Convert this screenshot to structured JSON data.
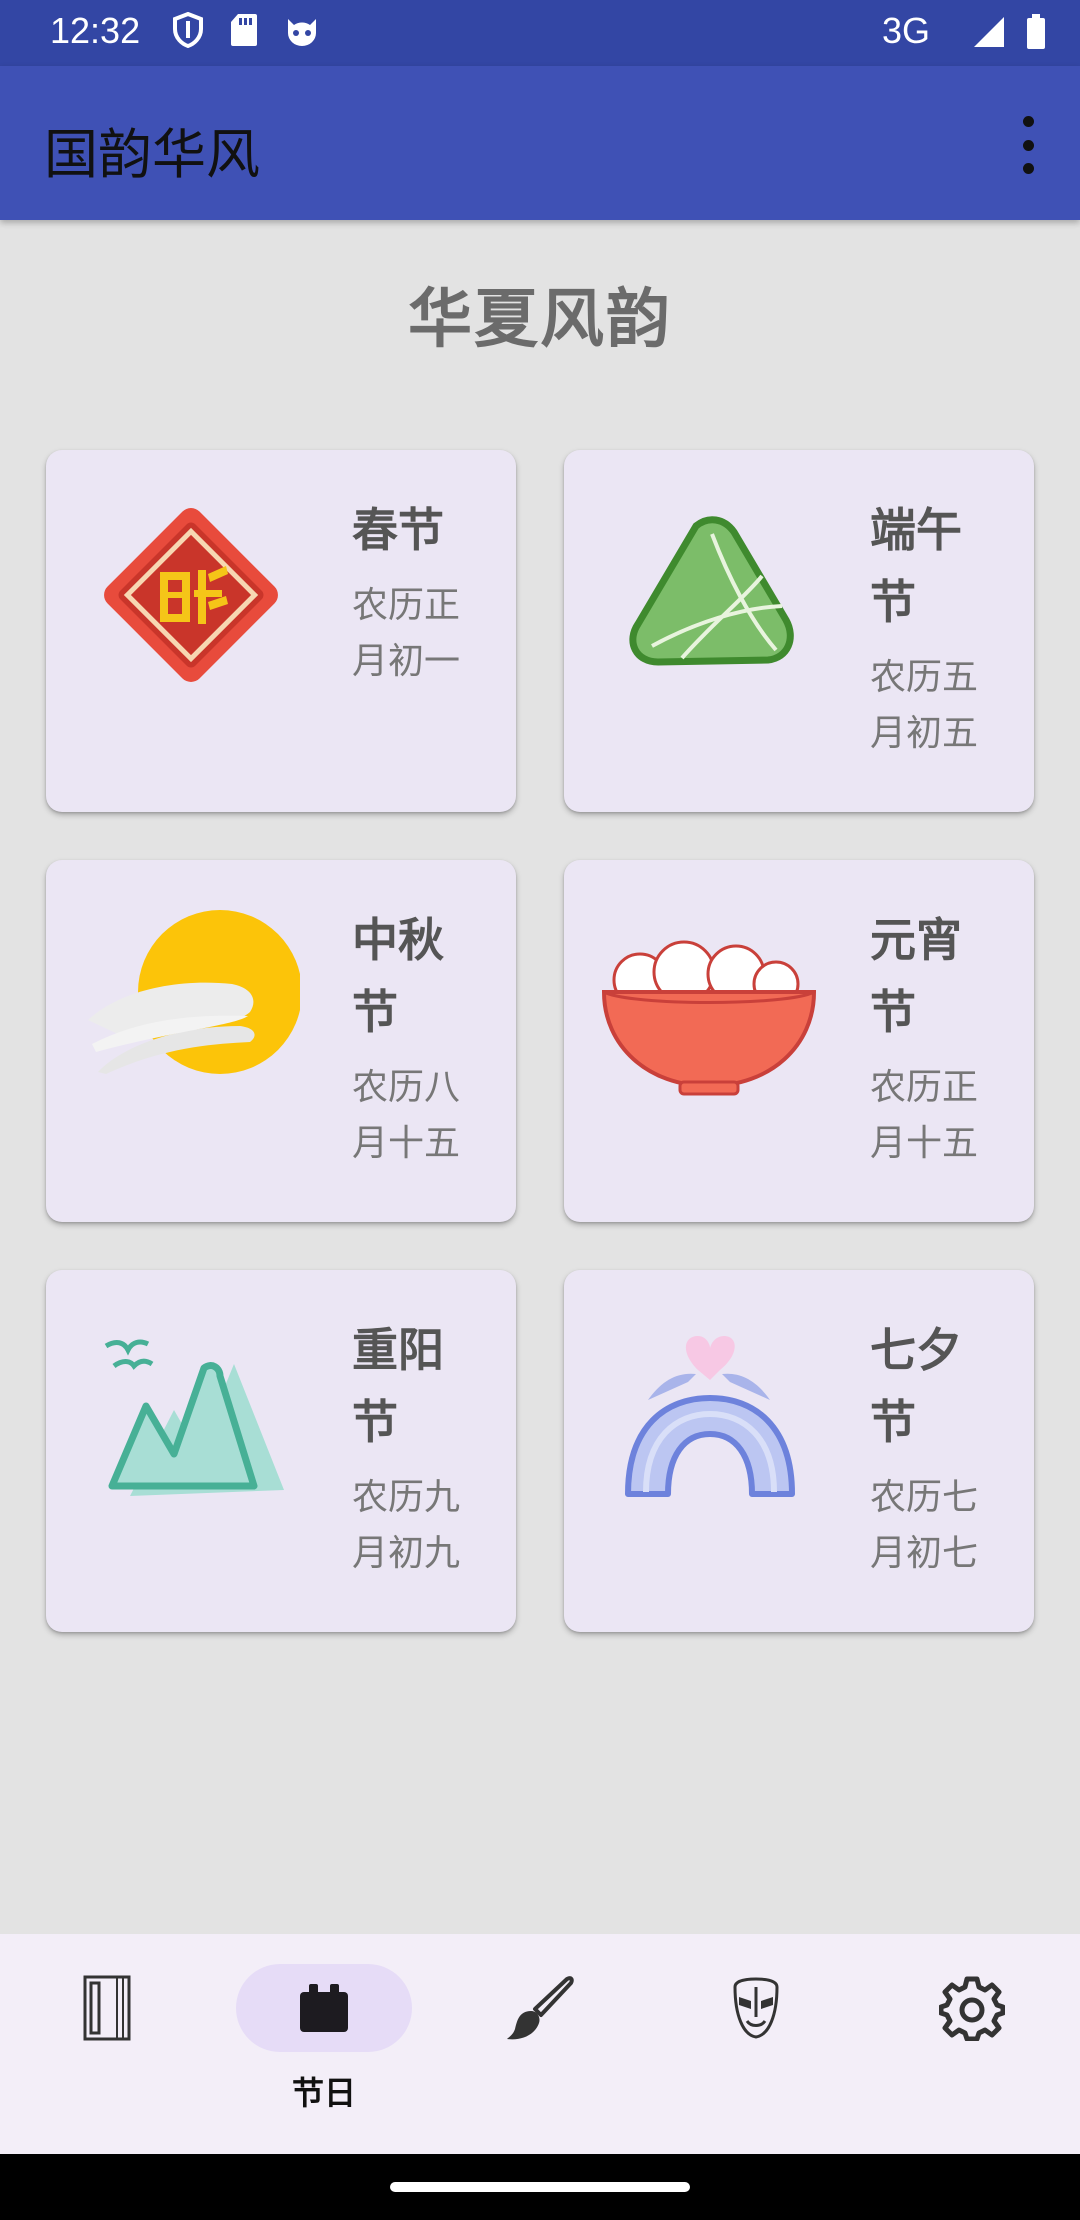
{
  "status_bar": {
    "time": "12:32",
    "network": "3G",
    "icons": [
      "shield-icon",
      "sd-card-icon",
      "cat-face-icon",
      "signal-icon",
      "battery-icon"
    ]
  },
  "app_bar": {
    "title": "国韵华风",
    "menu_icon": "more-vert-icon",
    "color": "#3f51b5"
  },
  "main": {
    "heading": "华夏风韵",
    "festivals": [
      {
        "name": "春节",
        "date": "农历正月初一",
        "icon": "fu-diamond-icon"
      },
      {
        "name": "端午节",
        "date": "农历五月初五",
        "icon": "zongzi-icon"
      },
      {
        "name": "中秋节",
        "date": "农历八月十五",
        "icon": "moon-cloud-icon"
      },
      {
        "name": "元宵节",
        "date": "农历正月十五",
        "icon": "tangyuan-bowl-icon"
      },
      {
        "name": "重阳节",
        "date": "农历九月初九",
        "icon": "mountain-icon"
      },
      {
        "name": "七夕节",
        "date": "农历七月初七",
        "icon": "magpie-bridge-icon"
      }
    ]
  },
  "bottom_nav": {
    "items": [
      {
        "icon": "book-icon",
        "label": ""
      },
      {
        "icon": "calendar-icon",
        "label": "节日",
        "active": true
      },
      {
        "icon": "brush-icon",
        "label": ""
      },
      {
        "icon": "opera-mask-icon",
        "label": ""
      },
      {
        "icon": "settings-gear-icon",
        "label": ""
      }
    ],
    "active_color": "#e6dcf7"
  }
}
